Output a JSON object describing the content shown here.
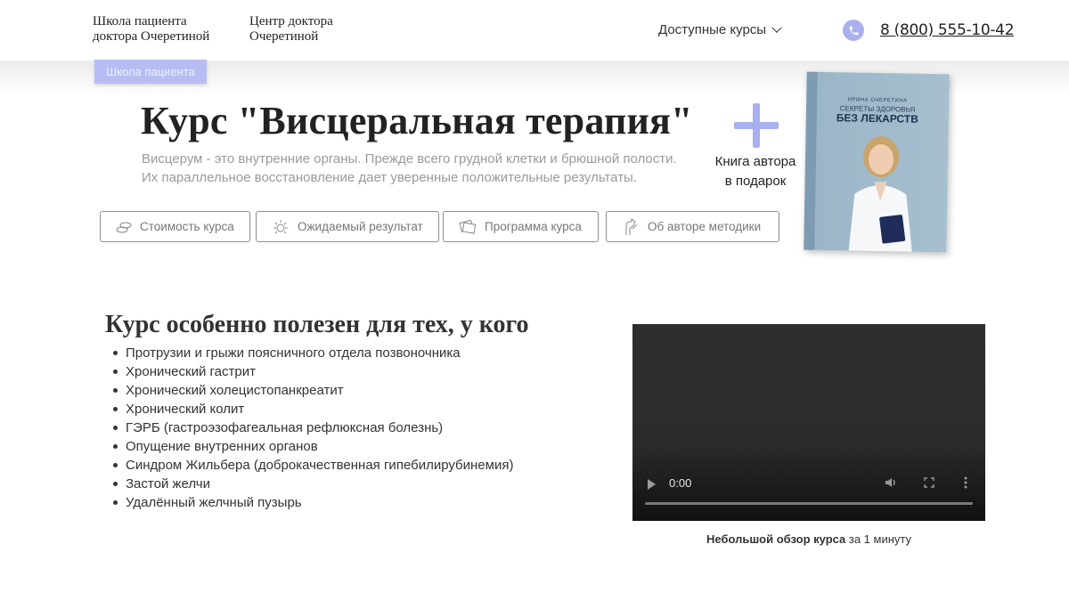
{
  "header": {
    "brand_school_line1": "Школа пациента",
    "brand_school_line2": "доктора Очеретиной",
    "brand_center_line1": "Центр доктора",
    "brand_center_line2": "Очеретиной",
    "courses_menu": "Доступные курсы",
    "phone": "8 (800) 555-10-42"
  },
  "breadcrumb": "Школа пациента",
  "hero": {
    "title": "Курс \"Висцеральная терапия\"",
    "description_line1": "Висцерум - это внутренние органы. Прежде всего грудной клетки и брюшной полости.",
    "description_line2": "Их параллельное восстановление дает уверенные положительные результаты.",
    "gift_line1": "Книга автора",
    "gift_line2": "в подарок"
  },
  "book": {
    "author": "ИРИНА ОЧЕРЕТИНА",
    "subtitle": "СЕКРЕТЫ ЗДОРОВЬЯ",
    "title": "БЕЗ ЛЕКАРСТВ"
  },
  "tabs": [
    {
      "label": "Стоимость курса",
      "icon": "coins-icon"
    },
    {
      "label": "Ожидаемый результат",
      "icon": "sun-icon"
    },
    {
      "label": "Программа курса",
      "icon": "cards-icon"
    },
    {
      "label": "Об авторе методики",
      "icon": "author-icon"
    }
  ],
  "conditions": {
    "title": "Курс особенно полезен для тех, у кого",
    "items": [
      "Протрузии и грыжи поясничного отдела позвоночника",
      "Хронический гастрит",
      "Хронический холецистопанкреатит",
      "Хронический колит",
      "ГЭРБ (гастроэзофагеальная рефлюксная болезнь)",
      "Опущение внутренних органов",
      "Синдром Жильбера (доброкачественная гипебилирубинемия)",
      "Застой желчи",
      "Удалённый желчный пузырь"
    ]
  },
  "video": {
    "time": "0:00",
    "caption_bold": "Небольшой обзор курса",
    "caption_rest": " за 1 минуту"
  },
  "colors": {
    "accent": "#aab0ee",
    "breadcrumb_bg": "#b7bdf3",
    "video_bg": "#2b2b2b"
  }
}
